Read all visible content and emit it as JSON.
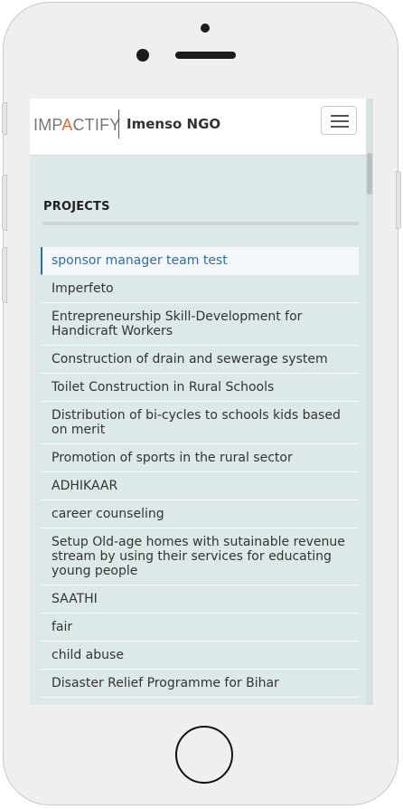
{
  "header": {
    "logo_prefix": "IMP",
    "logo_accent": "A",
    "logo_suffix": "CTIFY",
    "org_name": "Imenso NGO",
    "menu_button": "toggle-navigation"
  },
  "projects": {
    "title": "PROJECTS",
    "items": [
      "sponsor manager team test",
      "Imperfeto",
      "Entrepreneurship Skill-Development for Handicraft Workers",
      "Construction of drain and sewerage system",
      "Toilet Construction in Rural Schools",
      "Distribution of bi-cycles to schools kids based on merit",
      "Promotion of sports in the rural sector",
      "ADHIKAAR",
      "career counseling",
      "Setup Old-age homes with sutainable revenue stream by using their services for educating young people",
      "SAATHI",
      "fair",
      "child abuse",
      "Disaster Relief Programme for Bihar"
    ],
    "active_index": 0
  },
  "colors": {
    "accent": "#ea6a2b",
    "link_active": "#2f6ea3",
    "screen_bg": "#dde8e8"
  }
}
